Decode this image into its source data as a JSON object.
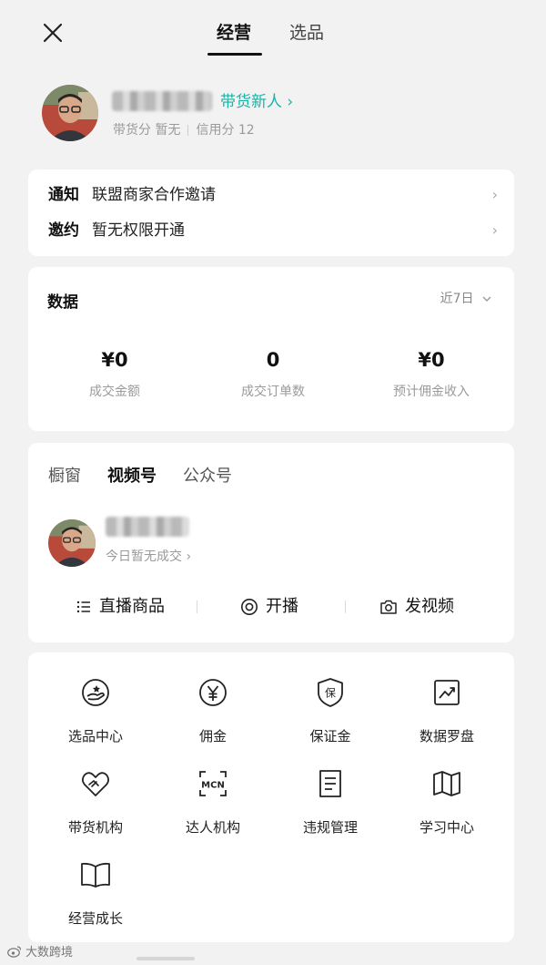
{
  "header": {
    "tabs": [
      {
        "label": "经营",
        "active": true
      },
      {
        "label": "选品",
        "active": false
      }
    ]
  },
  "profile": {
    "badge": "带货新人",
    "meta_left": "带货分 暂无",
    "meta_right": "信用分 12"
  },
  "notifications": [
    {
      "key": "通知",
      "value": "联盟商家合作邀请"
    },
    {
      "key": "邀约",
      "value": "暂无权限开通"
    }
  ],
  "data_panel": {
    "title": "数据",
    "range": "近7日",
    "stats": [
      {
        "value": "¥0",
        "label": "成交金额"
      },
      {
        "value": "0",
        "label": "成交订单数"
      },
      {
        "value": "¥0",
        "label": "预计佣金收入"
      }
    ]
  },
  "channels": {
    "tabs": [
      {
        "label": "橱窗",
        "active": false
      },
      {
        "label": "视频号",
        "active": true
      },
      {
        "label": "公众号",
        "active": false
      }
    ],
    "today": "今日暂无成交",
    "actions": [
      {
        "label": "直播商品",
        "icon": "list-icon"
      },
      {
        "label": "开播",
        "icon": "live-icon"
      },
      {
        "label": "发视频",
        "icon": "camera-icon"
      }
    ]
  },
  "tools": [
    {
      "label": "选品中心",
      "icon": "hand-coin-icon"
    },
    {
      "label": "佣金",
      "icon": "yen-icon"
    },
    {
      "label": "保证金",
      "icon": "shield-icon"
    },
    {
      "label": "数据罗盘",
      "icon": "trend-chart-icon"
    },
    {
      "label": "带货机构",
      "icon": "heart-handshake-icon"
    },
    {
      "label": "达人机构",
      "icon": "mcn-icon"
    },
    {
      "label": "违规管理",
      "icon": "document-icon"
    },
    {
      "label": "学习中心",
      "icon": "map-book-icon"
    },
    {
      "label": "经营成长",
      "icon": "open-book-icon"
    }
  ],
  "watermark": "大数跨境",
  "colors": {
    "accent": "#18b3a7",
    "background": "#f2f2f2",
    "card": "#ffffff"
  }
}
